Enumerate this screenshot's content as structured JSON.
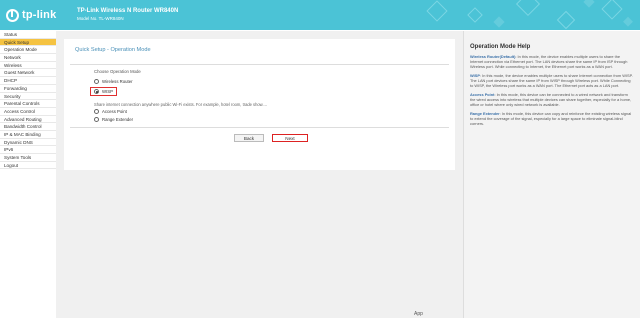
{
  "header": {
    "logo": "tp-link",
    "title": "TP-Link Wireless N Router WR840N",
    "model": "Model No. TL-WR840N"
  },
  "sidebar": {
    "items": [
      {
        "label": "Status",
        "active": false
      },
      {
        "label": "Quick Setup",
        "active": true
      },
      {
        "label": "Operation Mode",
        "active": false
      },
      {
        "label": "Network",
        "active": false
      },
      {
        "label": "Wireless",
        "active": false
      },
      {
        "label": "Guest Network",
        "active": false
      },
      {
        "label": "DHCP",
        "active": false
      },
      {
        "label": "Forwarding",
        "active": false
      },
      {
        "label": "Security",
        "active": false
      },
      {
        "label": "Parental Controls",
        "active": false
      },
      {
        "label": "Access Control",
        "active": false
      },
      {
        "label": "Advanced Routing",
        "active": false
      },
      {
        "label": "Bandwidth Control",
        "active": false
      },
      {
        "label": "IP & MAC Binding",
        "active": false
      },
      {
        "label": "Dynamic DNS",
        "active": false
      },
      {
        "label": "IPv6",
        "active": false
      },
      {
        "label": "System Tools",
        "active": false
      },
      {
        "label": "Logout",
        "active": false
      }
    ]
  },
  "main": {
    "title": "Quick Setup - Operation Mode",
    "choose_label": "Choose Operation Mode",
    "options": {
      "wireless_router": "Wireless Router",
      "wisp": "WISP",
      "access_point": "Access Point",
      "range_extender": "Range Extender"
    },
    "selected": "wisp",
    "description": "Share internet connection anywhere public Wi-Fi exists. For example, hotel room, trade show....",
    "back_label": "Back",
    "next_label": "Next",
    "footer_app": "App"
  },
  "help": {
    "title": "Operation Mode Help",
    "paragraphs": [
      {
        "term": "Wireless Router(Default)",
        "text": ": In this mode, the device enables multiple users to share the Internet connection via Ethernet port. The LAN devices share the same IP from ISP through Wireless port. While connecting to Internet, the Ethernet port works as a WAN port."
      },
      {
        "term": "WISP",
        "text": ": In this mode, the device enables multiple users to share Internet connection from WISP. The LAN port devices share the same IP from WISP through Wireless port. While Connecting to WISP, the Wireless port works as a WAN port. The Ethernet port acts as a LAN port."
      },
      {
        "term": "Access Point",
        "text": ": In this mode, this device can be connected to a wired network and transform the wired access into wireless that multiple devices can share together, especially for a home, office or hotel where only wired network is available."
      },
      {
        "term": "Range Extender",
        "text": ": In this mode, this device can copy and reinforce the existing wireless signal to extend the coverage of the signal, especially for a large space to eliminate signal-blind corners."
      }
    ]
  },
  "colors": {
    "header_bg": "#4bc3d6",
    "active_nav": "#f5c342",
    "highlight": "#e03030",
    "title_blue": "#4a90b8"
  }
}
